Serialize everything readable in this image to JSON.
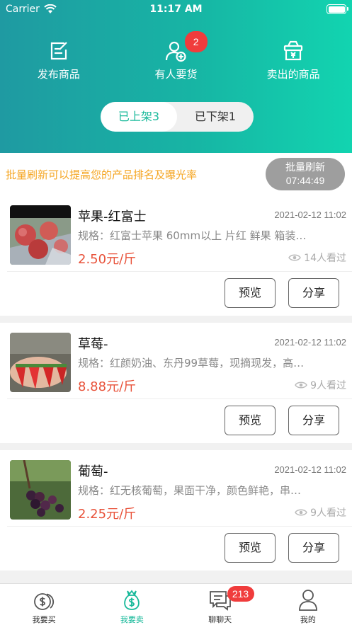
{
  "status_bar": {
    "carrier": "Carrier",
    "time": "11:17 AM"
  },
  "quick_actions": [
    {
      "label": "发布商品",
      "icon": "edit-icon"
    },
    {
      "label": "有人要货",
      "icon": "user-add-icon",
      "badge": "2"
    },
    {
      "label": "卖出的商品",
      "icon": "sold-basket-icon"
    }
  ],
  "segment": {
    "listed": "已上架3",
    "unlisted": "已下架1"
  },
  "notice": {
    "text": "批量刷新可以提高您的产品排名及曝光率",
    "refresh_label": "批量刷新",
    "refresh_timer": "07:44:49"
  },
  "products": [
    {
      "name": "苹果-红富士",
      "date": "2021-02-12 11:02",
      "spec": "规格：红富士苹果 60mm以上 片红 鲜果 箱装…",
      "price": "2.50元/斤",
      "views": "14人看过",
      "preview": "预览",
      "share": "分享"
    },
    {
      "name": "草莓-",
      "date": "2021-02-12 11:02",
      "spec": "规格：红颜奶油、东丹99草莓，现摘现发，高…",
      "price": "8.88元/斤",
      "views": "9人看过",
      "preview": "预览",
      "share": "分享"
    },
    {
      "name": "葡萄-",
      "date": "2021-02-12 11:02",
      "spec": "规格：红无核葡萄，果面干净，颜色鲜艳，串…",
      "price": "2.25元/斤",
      "views": "9人看过",
      "preview": "预览",
      "share": "分享"
    }
  ],
  "tabbar": [
    {
      "label": "我要买",
      "icon": "buy-coin-icon"
    },
    {
      "label": "我要卖",
      "icon": "sell-moneybag-icon",
      "active": true
    },
    {
      "label": "聊聊天",
      "icon": "chat-icon",
      "badge": "213"
    },
    {
      "label": "我的",
      "icon": "profile-icon"
    }
  ],
  "colors": {
    "accent": "#18b99a",
    "price": "#e8523a",
    "notice": "#f5a623",
    "badge": "#f03c3c"
  }
}
